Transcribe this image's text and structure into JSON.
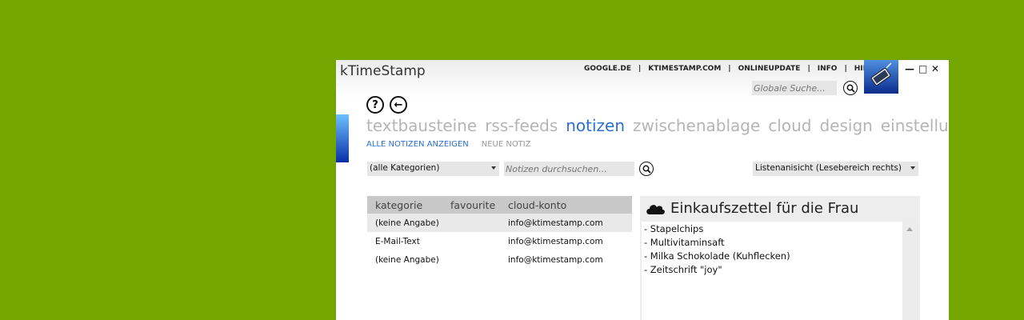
{
  "app": {
    "title": "kTimeStamp"
  },
  "toplinks": [
    "GOOGLE.DE",
    "KTIMESTAMP.COM",
    "ONLINEUPDATE",
    "INFO",
    "HILFE"
  ],
  "toplinks_separator": "|",
  "global_search": {
    "placeholder": "Globale Suche..."
  },
  "window_controls": {
    "minimize": "—",
    "maximize": "□",
    "close": "✕"
  },
  "nav": {
    "help": "?",
    "back": "←"
  },
  "tabs": [
    "textbausteine",
    "rss-feeds",
    "notizen",
    "zwischenablage",
    "cloud",
    "design",
    "einstellungen"
  ],
  "active_tab": "notizen",
  "subnav": {
    "show_all": "ALLE NOTIZEN ANZEIGEN",
    "new_note": "NEUE NOTIZ"
  },
  "filters": {
    "category_selected": "(alle Kategorien)",
    "notes_search_placeholder": "Notizen durchsuchen...",
    "view_selected": "Listenanisicht (Lesebereich rechts)"
  },
  "table": {
    "headers": [
      "kategorie",
      "favourite",
      "cloud-konto"
    ],
    "rows": [
      {
        "kategorie": "(keine Angabe)",
        "favourite": "",
        "cloud": "info@ktimestamp.com"
      },
      {
        "kategorie": "E-Mail-Text",
        "favourite": "",
        "cloud": "info@ktimestamp.com"
      },
      {
        "kategorie": "(keine Angabe)",
        "favourite": "",
        "cloud": "info@ktimestamp.com"
      }
    ]
  },
  "preview": {
    "title": "Einkaufszettel für die Frau",
    "lines": [
      "- Stapelchips",
      "- Multivitaminsaft",
      "- Milka Schokolade (Kuhflecken)",
      "- Zeitschrift \"joy\""
    ]
  },
  "colors": {
    "background": "#74a600",
    "accent": "#2e6fd4",
    "tab_inactive": "#b5b5b5"
  }
}
